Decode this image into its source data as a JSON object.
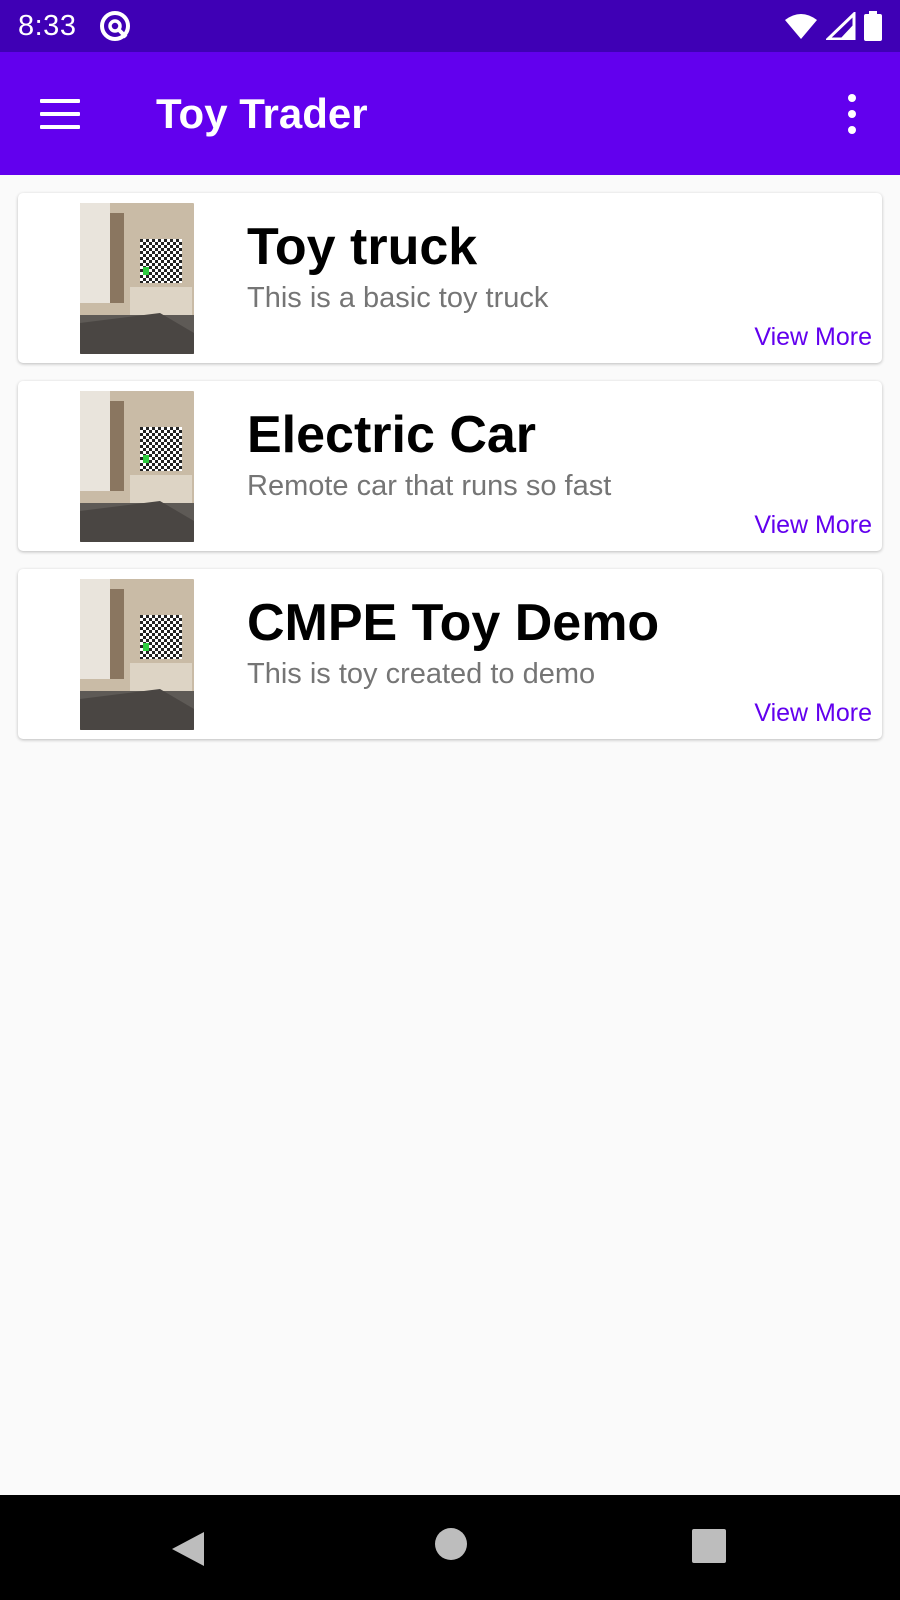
{
  "status_bar": {
    "time": "8:33",
    "icons": [
      "sync-icon",
      "wifi-icon",
      "signal-icon",
      "battery-icon"
    ]
  },
  "app_bar": {
    "title": "Toy Trader",
    "color": "#6200ee",
    "status_color": "#3f00b5",
    "icons": [
      "menu-icon",
      "overflow-menu-icon"
    ]
  },
  "toys": [
    {
      "title": "Toy truck",
      "description": "This is a basic toy truck",
      "action": "View More"
    },
    {
      "title": "Electric Car",
      "description": "Remote car that runs so fast",
      "action": "View More"
    },
    {
      "title": "CMPE Toy Demo",
      "description": "This is toy created to demo",
      "action": "View More"
    }
  ],
  "nav_bar": {
    "icons": [
      "back-icon",
      "home-icon",
      "recents-icon"
    ]
  }
}
